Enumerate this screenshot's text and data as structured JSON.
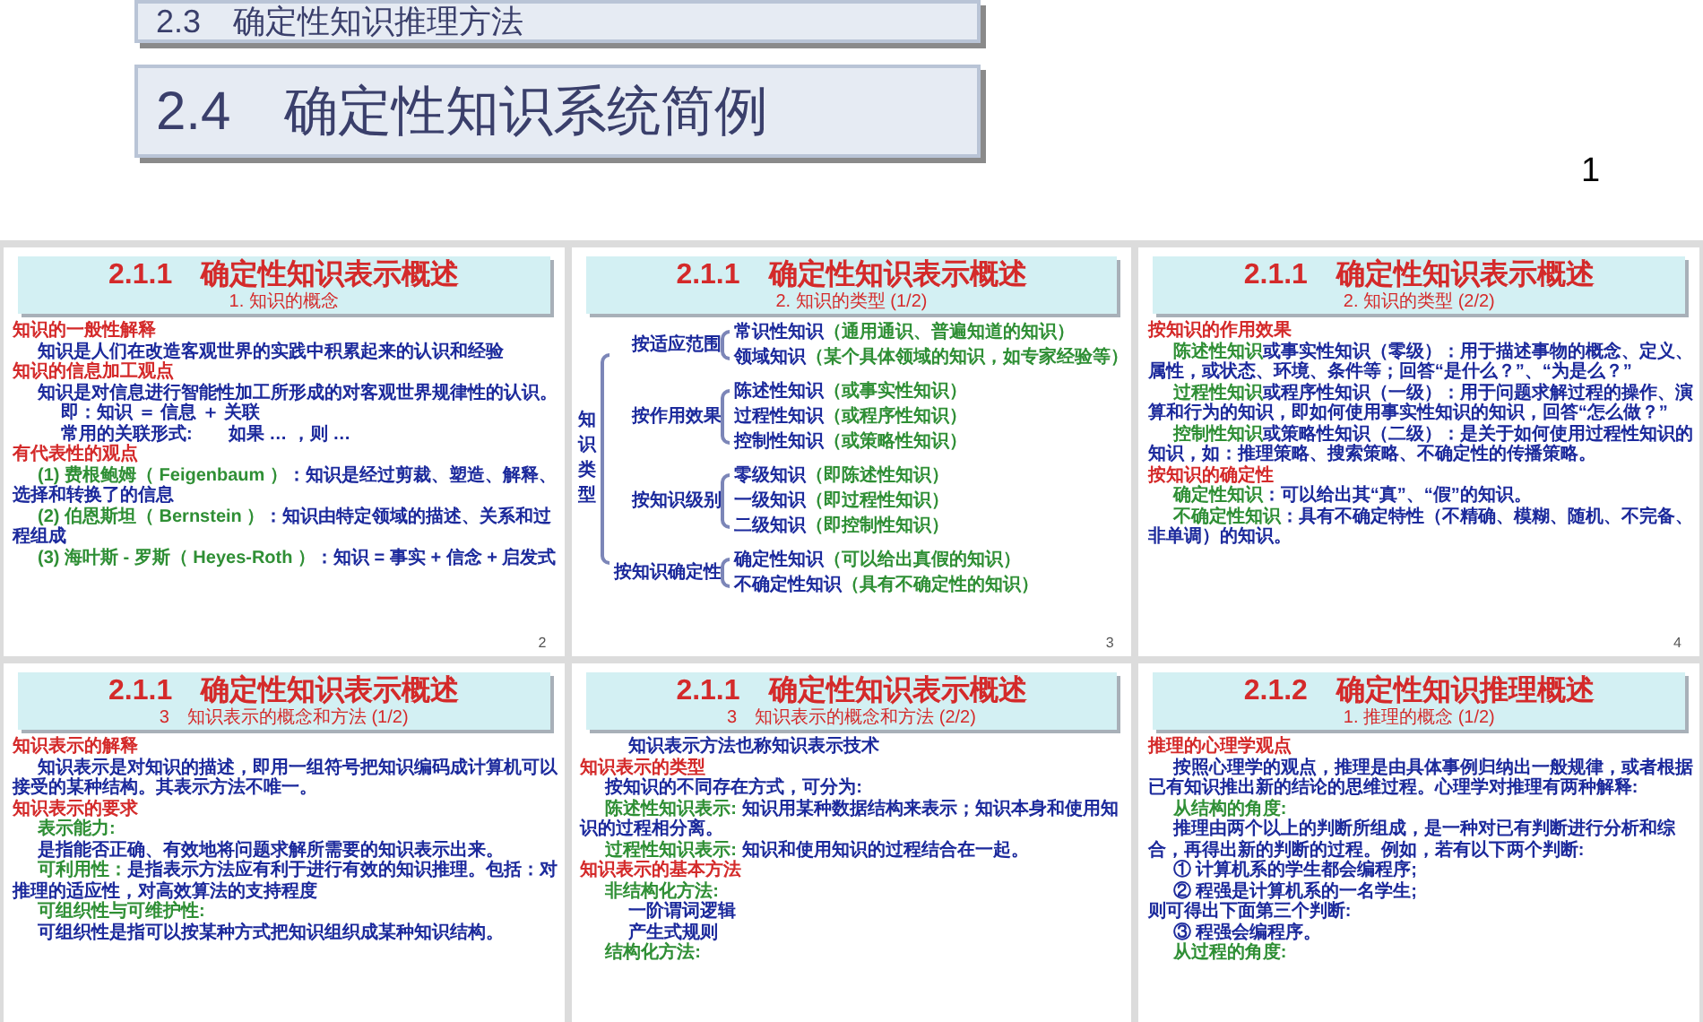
{
  "title_boxes": [
    "2.3　确定性知识推理方法",
    "2.4　确定性知识系统简例"
  ],
  "page_number": "1",
  "slides": [
    {
      "kind": "text",
      "title": "2.1.1　确定性知识表示概述",
      "subtitle": "1. 知识的概念",
      "number": "2",
      "lines": [
        {
          "kind": "heading",
          "text": "知识的一般性解释"
        },
        {
          "kind": "para",
          "text": "知识是人们在改造客观世界的实践中积累起来的认识和经验"
        },
        {
          "kind": "heading",
          "text": "知识的信息加工观点"
        },
        {
          "kind": "para",
          "text": "知识是对信息进行智能性加工所形成的对客观世界规律性的认识。"
        },
        {
          "kind": "sub",
          "text": "即：知识 ＝ 信息 ＋ 关联"
        },
        {
          "kind": "sub",
          "text": "常用的关联形式:　　如果 … ，则 …"
        },
        {
          "kind": "heading",
          "text": "有代表性的观点"
        },
        {
          "kind": "para",
          "label": "(1) 费根鲍姆（ Feigenbaum ）",
          "text": "：知识是经过剪裁、塑造、解释、选择和转换了的信息"
        },
        {
          "kind": "para",
          "label": "(2) 伯恩斯坦（ Bernstein ）",
          "text": "：知识由特定领域的描述、关系和过程组成"
        },
        {
          "kind": "para",
          "label": "(3) 海叶斯 - 罗斯（ Heyes-Roth ）",
          "text": "：知识 = 事实 + 信念 + 启发式"
        }
      ]
    },
    {
      "kind": "tree",
      "title": "2.1.1　确定性知识表示概述",
      "subtitle": "2. 知识的类型 (1/2)",
      "number": "3",
      "tree": {
        "label": "知识类型",
        "children": [
          {
            "label": "按适应范围",
            "children": [
              {
                "label": "常识性知识",
                "note": "（通用通识、普遍知道的知识）"
              },
              {
                "label": "领域知识",
                "note": "（某个具体领域的知识，如专家经验等）"
              }
            ]
          },
          {
            "label": "按作用效果",
            "children": [
              {
                "label": "陈述性知识",
                "note": "（或事实性知识）"
              },
              {
                "label": "过程性知识",
                "note": "（或程序性知识）"
              },
              {
                "label": "控制性知识",
                "note": "（或策略性知识）"
              }
            ]
          },
          {
            "label": "按知识级别",
            "children": [
              {
                "label": "零级知识",
                "note": "（即陈述性知识）"
              },
              {
                "label": "一级知识",
                "note": "（即过程性知识）"
              },
              {
                "label": "二级知识",
                "note": "（即控制性知识）"
              }
            ]
          },
          {
            "label": "按知识确定性",
            "children": [
              {
                "label": "确定性知识",
                "note": "（可以给出真假的知识）"
              },
              {
                "label": "不确定性知识",
                "note": "（具有不确定性的知识）"
              }
            ]
          }
        ]
      }
    },
    {
      "kind": "text",
      "title": "2.1.1　确定性知识表示概述",
      "subtitle": "2. 知识的类型 (2/2)",
      "number": "4",
      "lines": [
        {
          "kind": "heading",
          "text": "按知识的作用效果"
        },
        {
          "kind": "para",
          "label": "陈述性知识",
          "text": "或事实性知识（零级）：用于描述事物的概念、定义、属性，或状态、环境、条件等；回答“是什么？”、“为是么？”"
        },
        {
          "kind": "para",
          "label": "过程性知识",
          "text": "或程序性知识（一级）：用于问题求解过程的操作、演算和行为的知识，即如何使用事实性知识的知识，回答“怎么做？”"
        },
        {
          "kind": "para",
          "label": "控制性知识",
          "text": "或策略性知识（二级）：是关于如何使用过程性知识的知识，如：推理策略、搜索策略、不确定性的传播策略。"
        },
        {
          "kind": "heading",
          "text": "按知识的确定性"
        },
        {
          "kind": "para",
          "label": "确定性知识",
          "text": "：可以给出其“真”、“假”的知识。"
        },
        {
          "kind": "para",
          "label": "不确定性知识",
          "text": "：具有不确定特性（不精确、模糊、随机、不完备、非单调）的知识。"
        }
      ]
    },
    {
      "kind": "text",
      "title": "2.1.1　确定性知识表示概述",
      "subtitle": "3　知识表示的概念和方法 (1/2)",
      "lines": [
        {
          "kind": "heading",
          "text": "知识表示的解释"
        },
        {
          "kind": "para",
          "text": "知识表示是对知识的描述，即用一组符号把知识编码成计算机可以接受的某种结构。其表示方法不唯一。"
        },
        {
          "kind": "heading",
          "text": "知识表示的要求"
        },
        {
          "kind": "para",
          "label": "表示能力:"
        },
        {
          "kind": "para",
          "text": "是指能否正确、有效地将问题求解所需要的知识表示出来。"
        },
        {
          "kind": "para",
          "label": "可利用性：",
          "text": "是指表示方法应有利于进行有效的知识推理。包括：对推理的适应性，对高效算法的支持程度"
        },
        {
          "kind": "para",
          "label": "可组织性与可维护性:"
        },
        {
          "kind": "para",
          "text": "可组织性是指可以按某种方式把知识组织成某种知识结构。"
        }
      ]
    },
    {
      "kind": "text",
      "title": "2.1.1　确定性知识表示概述",
      "subtitle": "3　知识表示的概念和方法 (2/2)",
      "lines": [
        {
          "kind": "sub",
          "text": "知识表示方法也称知识表示技术"
        },
        {
          "kind": "heading",
          "text": "知识表示的类型"
        },
        {
          "kind": "para",
          "text": "按知识的不同存在方式，可分为:"
        },
        {
          "kind": "para",
          "label": "陈述性知识表示:",
          "text": " 知识用某种数据结构来表示；知识本身和使用知识的过程相分离。"
        },
        {
          "kind": "para",
          "label": "过程性知识表示:",
          "text": " 知识和使用知识的过程结合在一起。"
        },
        {
          "kind": "heading",
          "text": "知识表示的基本方法"
        },
        {
          "kind": "para",
          "label": "非结构化方法:"
        },
        {
          "kind": "sub",
          "text": "一阶谓词逻辑"
        },
        {
          "kind": "sub",
          "text": "产生式规则"
        },
        {
          "kind": "para",
          "label": "结构化方法:"
        }
      ]
    },
    {
      "kind": "text",
      "title": "2.1.2　确定性知识推理概述",
      "subtitle": "1. 推理的概念 (1/2)",
      "lines": [
        {
          "kind": "heading",
          "text": "推理的心理学观点"
        },
        {
          "kind": "para",
          "text": "按照心理学的观点，推理是由具体事例归纳出一般规律，或者根据已有知识推出新的结论的思维过程。心理学对推理有两种解释:"
        },
        {
          "kind": "para",
          "label": "从结构的角度:"
        },
        {
          "kind": "para",
          "text": "推理由两个以上的判断所组成，是一种对已有判断进行分析和综合，再得出新的判断的过程。例如，若有以下两个判断:"
        },
        {
          "kind": "para",
          "text": "① 计算机系的学生都会编程序;"
        },
        {
          "kind": "para",
          "text": "② 程强是计算机系的一名学生;"
        },
        {
          "kind": "plain",
          "text": "则可得出下面第三个判断:"
        },
        {
          "kind": "para",
          "text": "③ 程强会编程序。"
        },
        {
          "kind": "para",
          "label": "从过程的角度:"
        }
      ]
    }
  ]
}
